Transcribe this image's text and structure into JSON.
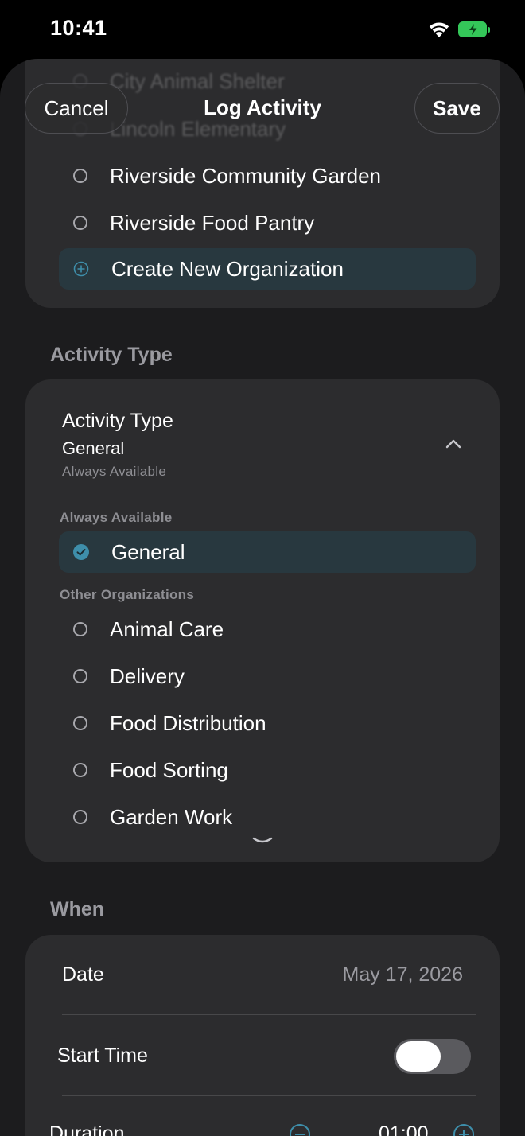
{
  "status_bar": {
    "time": "10:41"
  },
  "header": {
    "title": "Log Activity",
    "cancel_label": "Cancel",
    "save_label": "Save"
  },
  "organizations": {
    "faded_items": [
      "City Animal Shelter",
      "Lincoln Elementary"
    ],
    "items": [
      "Riverside Community Garden",
      "Riverside Food Pantry"
    ],
    "create_label": "Create New Organization"
  },
  "activity_section": {
    "label": "Activity Type",
    "picker_title": "Activity Type",
    "selected_value": "General",
    "selected_group": "Always Available",
    "group_always": "Always Available",
    "always_items": [
      "General"
    ],
    "group_other": "Other Organizations",
    "other_items": [
      "Animal Care",
      "Delivery",
      "Food Distribution",
      "Food Sorting",
      "Garden Work"
    ]
  },
  "when_section": {
    "label": "When",
    "date_label": "Date",
    "date_value": "May 17, 2026",
    "start_time_label": "Start Time",
    "start_time_enabled": false,
    "duration_label": "Duration",
    "duration_value": "01:00"
  },
  "colors": {
    "accent": "#3e8eaa",
    "sheet_bg": "#1c1c1e",
    "card_bg": "#2c2c2e",
    "highlight_bg": "#28383f",
    "battery": "#34c759"
  }
}
